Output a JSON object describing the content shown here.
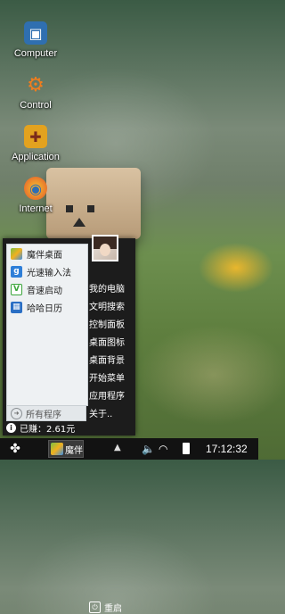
{
  "desktop": {
    "icons": [
      {
        "label": "Computer",
        "icon": "monitor-icon"
      },
      {
        "label": "Control",
        "icon": "gear-icon"
      },
      {
        "label": "Application",
        "icon": "toolbox-icon"
      },
      {
        "label": "Internet",
        "icon": "globe-icon"
      }
    ]
  },
  "start_menu": {
    "apps": [
      {
        "label": "魔伴桌面",
        "icon": "moban-desktop-icon",
        "color": "#7ac143"
      },
      {
        "label": "光速输入法",
        "icon": "input-method-icon",
        "color": "#2f7fd8"
      },
      {
        "label": "音速启动",
        "icon": "launcher-icon",
        "color": "#3aa53a"
      },
      {
        "label": "哈哈日历",
        "icon": "calendar-icon",
        "color": "#2a6fc4"
      }
    ],
    "all_programs": "所有程序",
    "right_items": [
      "我的电脑",
      "文明搜索",
      "控制面板",
      "桌面图标",
      "桌面背景",
      "开始菜单",
      "应用程序",
      "关于.."
    ],
    "earnings": "已赚：2.61元",
    "restart": "重启"
  },
  "taskbar": {
    "task_label": "魔伴",
    "time": "17:12:32"
  }
}
